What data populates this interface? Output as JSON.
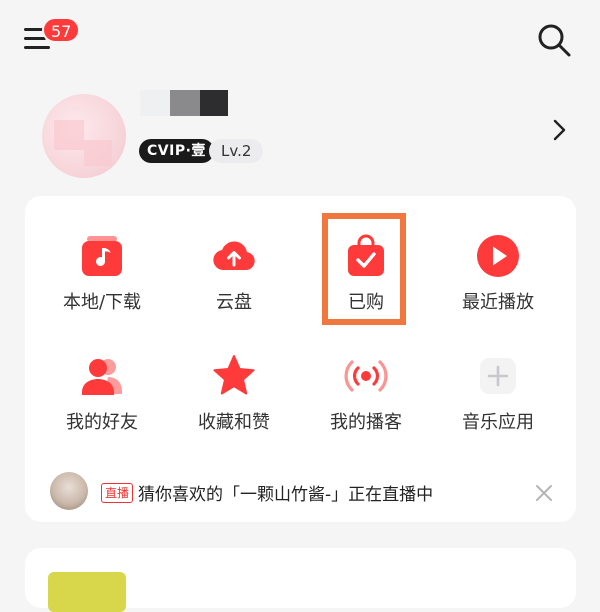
{
  "header": {
    "notification_count": "57"
  },
  "profile": {
    "vip_label": "CVIP·壹",
    "level": "Lv.2"
  },
  "grid": {
    "items": [
      {
        "label": "本地/下载",
        "icon": "music-folder-icon"
      },
      {
        "label": "云盘",
        "icon": "cloud-upload-icon"
      },
      {
        "label": "已购",
        "icon": "shopping-bag-check-icon"
      },
      {
        "label": "最近播放",
        "icon": "play-circle-icon"
      },
      {
        "label": "我的好友",
        "icon": "friends-icon"
      },
      {
        "label": "收藏和赞",
        "icon": "star-icon"
      },
      {
        "label": "我的播客",
        "icon": "podcast-broadcast-icon"
      },
      {
        "label": "音乐应用",
        "icon": "add-app-icon"
      }
    ]
  },
  "live": {
    "tag": "直播",
    "text": "猜你喜欢的「一颗山竹酱-」正在直播中"
  },
  "colors": {
    "accent": "#fe3a3b",
    "highlight_box": "#f0773e",
    "background": "#f5f5f6"
  }
}
